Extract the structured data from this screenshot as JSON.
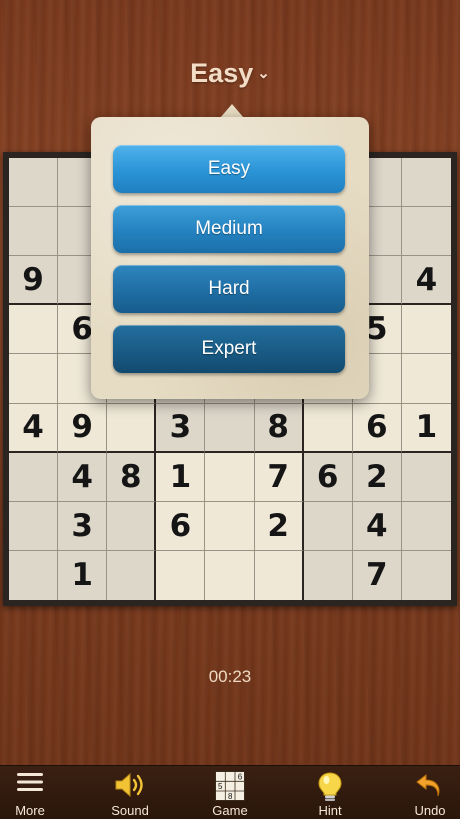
{
  "header": {
    "difficulty": "Easy",
    "chevron": "⌄"
  },
  "board": {
    "rows": [
      [
        "",
        "",
        "",
        "",
        "",
        "",
        "",
        "",
        ""
      ],
      [
        "",
        "",
        "",
        "",
        "",
        "",
        "",
        "",
        ""
      ],
      [
        "9",
        "",
        "",
        "",
        "",
        "",
        "",
        "",
        "4"
      ],
      [
        "",
        "6",
        "",
        "",
        "",
        "",
        "",
        "5",
        ""
      ],
      [
        "",
        "",
        "",
        "",
        "",
        "",
        "",
        "",
        ""
      ],
      [
        "4",
        "9",
        "",
        "3",
        "",
        "8",
        "",
        "6",
        "1"
      ],
      [
        "",
        "4",
        "8",
        "1",
        "",
        "7",
        "6",
        "2",
        ""
      ],
      [
        "",
        "3",
        "",
        "6",
        "",
        "2",
        "",
        "4",
        ""
      ],
      [
        "",
        "1",
        "",
        "",
        "",
        "",
        "",
        "7",
        ""
      ]
    ]
  },
  "difficulty_menu": {
    "options": [
      {
        "label": "Easy"
      },
      {
        "label": "Medium"
      },
      {
        "label": "Hard"
      },
      {
        "label": "Expert"
      }
    ]
  },
  "timer": "00:23",
  "toolbar": {
    "more": {
      "label": "More",
      "icon": "hamburger-icon"
    },
    "sound": {
      "label": "Sound",
      "icon": "speaker-icon"
    },
    "game": {
      "label": "Game",
      "icon": "mini-grid-icon",
      "icon_digits": [
        "5",
        "6",
        "8"
      ]
    },
    "hint": {
      "label": "Hint",
      "icon": "lightbulb-icon"
    },
    "undo": {
      "label": "Undo",
      "icon": "undo-arrow-icon"
    }
  },
  "colors": {
    "wood": "#7d3d20",
    "button_blue": "#2b94d6",
    "toolbar_icon": "#f2c335"
  }
}
